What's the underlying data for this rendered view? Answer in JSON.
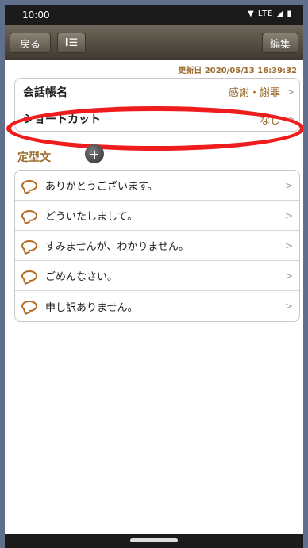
{
  "status": {
    "time": "10:00",
    "indicators": "▼ LTE ◢ ▮"
  },
  "toolbar": {
    "back_label": "戻る",
    "sort_icon": "sort-icon",
    "edit_label": "編集"
  },
  "updated_label": "更新日 2020/05/13 16:39:32",
  "settings": [
    {
      "label": "会話帳名",
      "value": "感謝・謝罪"
    },
    {
      "label": "ショートカット",
      "value": "なし"
    }
  ],
  "section": {
    "title": "定型文",
    "add_icon": "plus-circle-icon"
  },
  "phrases": [
    {
      "text": "ありがとうございます。",
      "icon": "double-bubble"
    },
    {
      "text": "どういたしまして。",
      "icon": "bubble"
    },
    {
      "text": "すみませんが、わかりません。",
      "icon": "bubble"
    },
    {
      "text": "ごめんなさい。",
      "icon": "bubble"
    },
    {
      "text": "申し訳ありません。",
      "icon": "bubble"
    }
  ],
  "colors": {
    "accent": "#9b6a2d",
    "highlight": "#ee1c1c",
    "toolbar": "#4e4739"
  }
}
